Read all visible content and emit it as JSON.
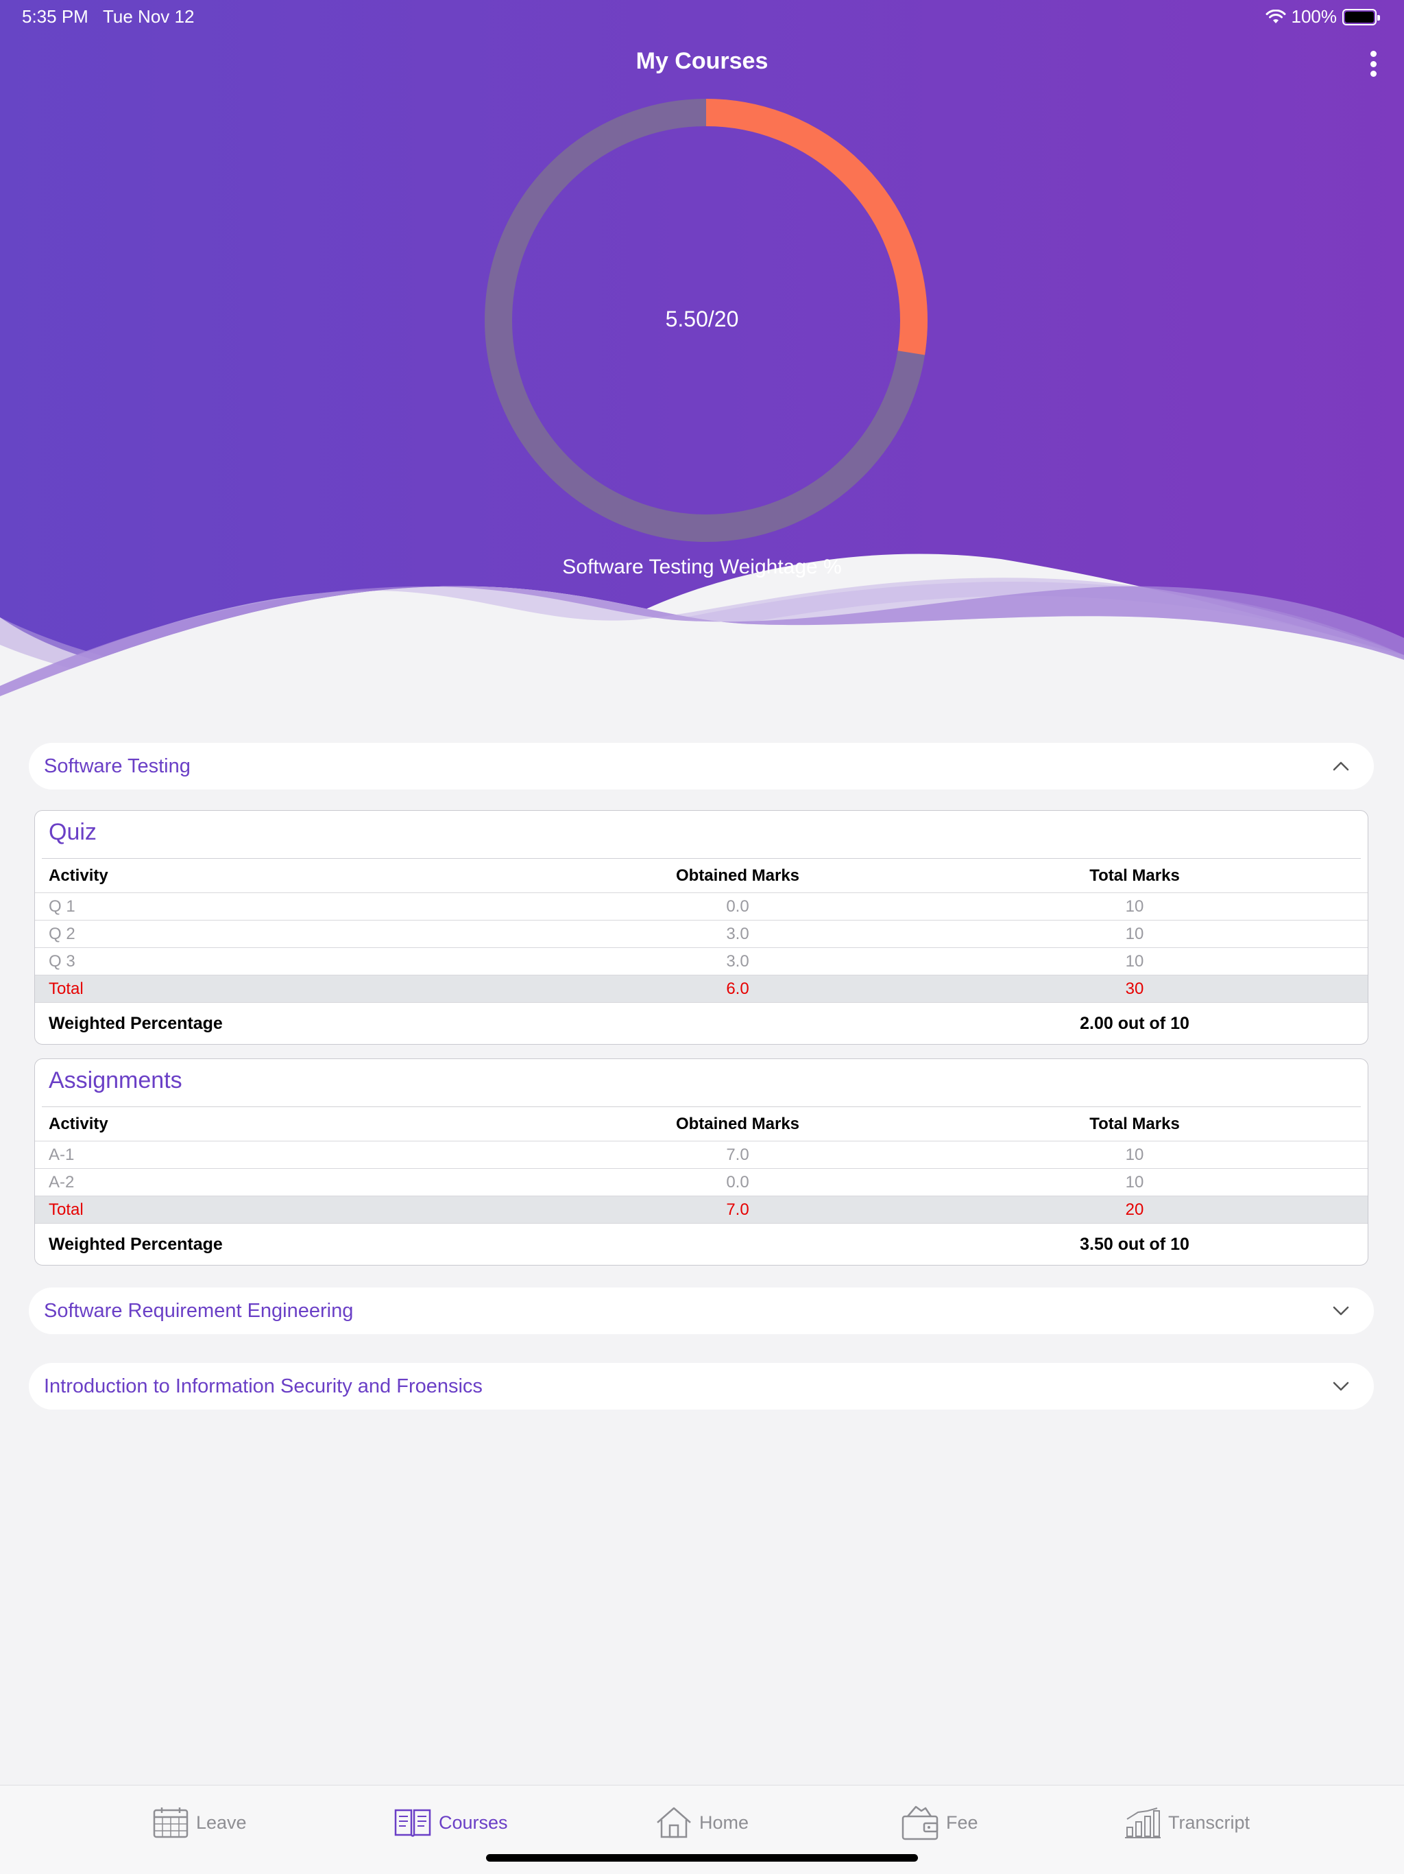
{
  "status_bar": {
    "time": "5:35 PM",
    "date": "Tue Nov 12",
    "battery": "100%"
  },
  "header": {
    "title": "My Courses"
  },
  "donut": {
    "value": 5.5,
    "max": 20,
    "label": "5.50/20",
    "caption": "Software Testing Weightage %",
    "fill_color": "#fb7352",
    "track_color": "#7b679b"
  },
  "courses": [
    {
      "name": "Software Testing",
      "expanded": true
    },
    {
      "name": "Software Requirement Engineering",
      "expanded": false
    },
    {
      "name": "Introduction to Information Security and Froensics",
      "expanded": false
    }
  ],
  "columns": {
    "activity": "Activity",
    "obtained": "Obtained Marks",
    "total": "Total Marks"
  },
  "quiz": {
    "title": "Quiz",
    "rows": [
      {
        "activity": "Q 1",
        "obtained": "0.0",
        "total": "10"
      },
      {
        "activity": "Q 2",
        "obtained": "3.0",
        "total": "10"
      },
      {
        "activity": "Q 3",
        "obtained": "3.0",
        "total": "10"
      }
    ],
    "total_row": {
      "activity": "Total",
      "obtained": "6.0",
      "total": "30"
    },
    "weighted_label": "Weighted Percentage",
    "weighted_value": "2.00 out of 10"
  },
  "assignments": {
    "title": "Assignments",
    "rows": [
      {
        "activity": "A-1",
        "obtained": "7.0",
        "total": "10"
      },
      {
        "activity": "A-2",
        "obtained": "0.0",
        "total": "10"
      }
    ],
    "total_row": {
      "activity": "Total",
      "obtained": "7.0",
      "total": "20"
    },
    "weighted_label": "Weighted Percentage",
    "weighted_value": "3.50 out of 10"
  },
  "tabs": [
    {
      "label": "Leave",
      "icon": "calendar-icon",
      "active": false
    },
    {
      "label": "Courses",
      "icon": "book-icon",
      "active": true
    },
    {
      "label": "Home",
      "icon": "home-icon",
      "active": false
    },
    {
      "label": "Fee",
      "icon": "wallet-icon",
      "active": false
    },
    {
      "label": "Transcript",
      "icon": "chart-icon",
      "active": false
    }
  ],
  "colors": {
    "accent": "#6a3fc6",
    "header_gradient_start": "#6a45c4",
    "header_gradient_end": "#7e3bbd",
    "total_text": "#e60000"
  }
}
